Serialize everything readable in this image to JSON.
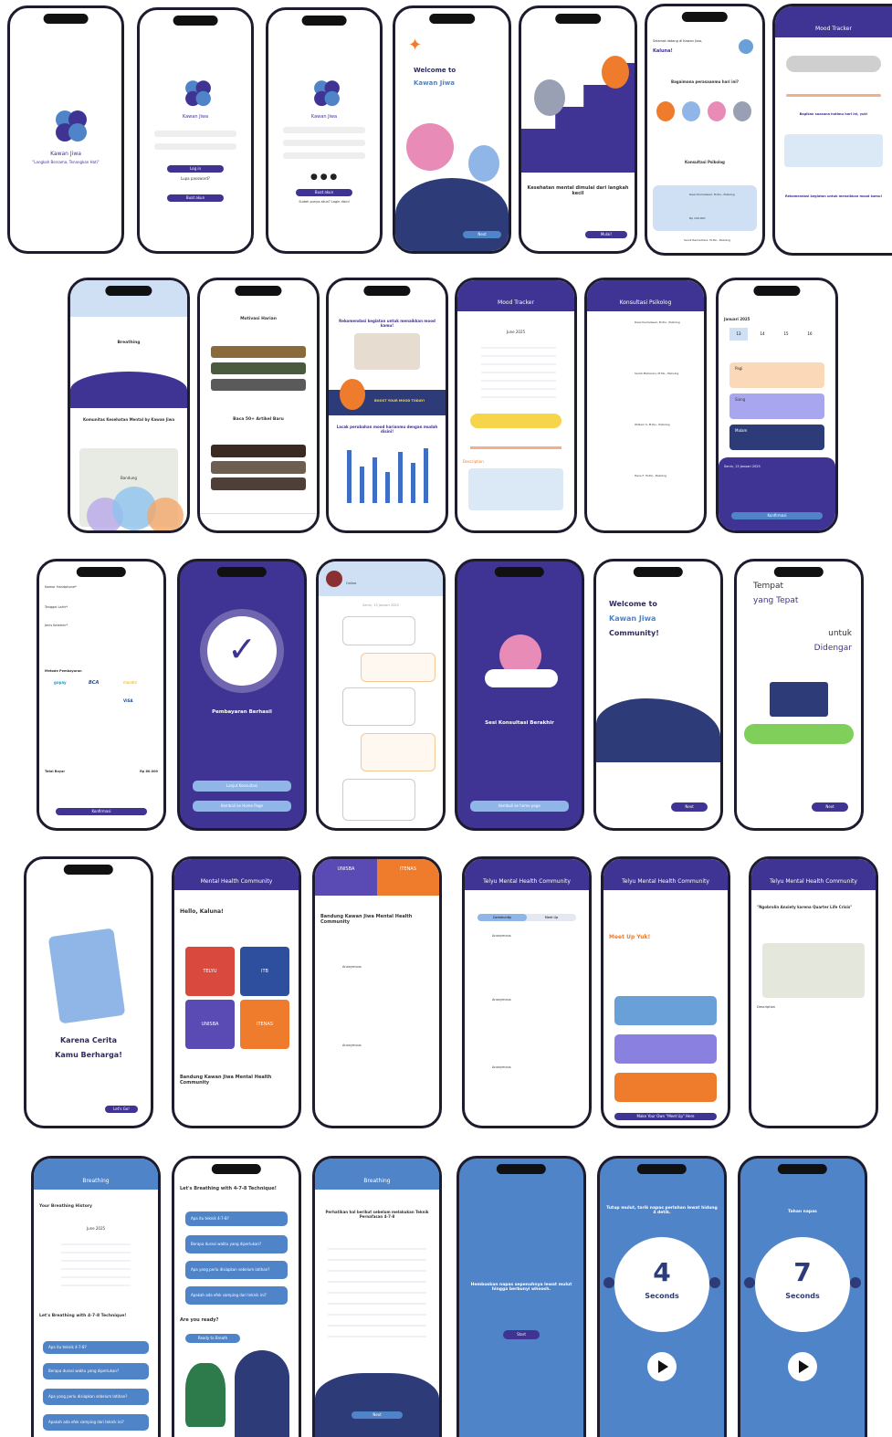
{
  "row1": {
    "splash_app_name": "Kawan Jiwa",
    "splash_tagline": "\"Langkah Bersama, Tenangkan Hati\"",
    "login_title": "Kawan Jiwa",
    "login_btn": "Log in",
    "login_forgot": "Lupa password?",
    "login_register": "Buat akun",
    "register_title": "Kawan Jiwa",
    "register_btn": "Buat akun",
    "register_login": "Sudah punya akun? Login disini",
    "welcome_title_1": "Welcome to",
    "welcome_title_2": "Kawan Jiwa",
    "welcome_next": "Next",
    "onb2_title": "Kesehatan mental dimulai dari langkah kecil",
    "onb2_btn": "Mulai!",
    "home_greeting": "Selamat datang di Kawan Jiwa,",
    "home_user": "Kaluna!",
    "home_question": "Bagaimana perasaanmu hari ini?",
    "home_konsultasi": "Konsultasi Psikolog",
    "home_psych_1": "Dewi Kumalasari, M.Psi., Psikolog",
    "home_price": "Rp 100.000",
    "home_psych_2": "Sandi Ramadhani, M.Psi., Psikolog",
    "mood_header": "Mood Tracker",
    "mood_share": "Bagikan suasana hatimu hari ini, yuk!",
    "mood_reco": "Rekomendasi kegiatan untuk menaikkan mood kamu!"
  },
  "row2": {
    "breathing_title": "Breathing",
    "community_title": "Komunitas Kesehatan Mental by Kawan Jiwa",
    "map_city": "Bandung",
    "motivasi_title": "Motivasi Harian",
    "artikel_title": "Baca 50+ Artikel Baru",
    "reco_title": "Rekomendasi kegiatan untuk menaikkan mood kamu!",
    "boost_banner": "BOOST YOUR MOOD TODAY!",
    "chart_title": "Lacak perubahan mood harianmu dengan mudah disini!",
    "calendar_header": "Mood Tracker",
    "calendar_month": "June 2025",
    "description_label": "Description",
    "konsultasi_header": "Konsultasi Psikolog",
    "psych_a": "Dewi Kumalasari, M.Psi., Psikolog",
    "psych_b": "Sarah Maharani, M.Psi., Psikolog",
    "psych_c": "William S, M.Psi., Psikolog",
    "psych_d": "Hans F, M.Psi., Psikolog",
    "schedule_month": "Januari 2025",
    "schedule_days": [
      "13",
      "14",
      "15",
      "16"
    ],
    "pagi": "Pagi",
    "siang": "Siang",
    "malam": "Malam",
    "konfirmasi": "Konfirmasi",
    "booking_date": "Senin, 13 Januari 2025"
  },
  "row3": {
    "pay_phone_label": "Nomor Handphone*",
    "pay_birth_label": "Tanggal Lahir*",
    "pay_gender_label": "Jenis Kelamin*",
    "pay_method_label": "Metode Pembayaran",
    "pay_methods": [
      "gopay",
      "BCA",
      "mandiri",
      "",
      "",
      "VISA"
    ],
    "pay_total_label": "Total Bayar",
    "pay_total": "Rp 80.000",
    "pay_confirm": "Konfirmasi",
    "success_title": "Pembayaran Berhasil",
    "success_btn1": "Lanjut Konsultasi",
    "success_btn2": "Kembali ke Home Page",
    "chat_status": "Online",
    "chat_date": "Senin, 13 Januari 2025",
    "session_end_title": "Sesi Konsultasi Berakhir",
    "session_end_btn": "Kembali ke home page",
    "comm_welcome_1": "Welcome to",
    "comm_welcome_2": "Kawan Jiwa",
    "comm_welcome_3": "Community!",
    "comm_next": "Next",
    "place_1": "Tempat",
    "place_2": "yang Tepat",
    "place_3": "untuk",
    "place_4": "Didengar",
    "place_next": "Next"
  },
  "row4": {
    "story_1": "Karena Cerita",
    "story_2": "Kamu Berharga!",
    "story_btn": "Let's Go!",
    "mhc_header": "Mental Health Community",
    "mhc_hello": "Hello, Kaluna!",
    "mhc_tiles": [
      "TELYU",
      "ITB",
      "UNISBA",
      "ITENAS"
    ],
    "mhc_bottom": "Bandung Kawan Jiwa Mental Health Community",
    "bkj_title": "Bandung Kawan Jiwa Mental Health Community",
    "bkj_banner": [
      "UNISBA",
      "ITENAS"
    ],
    "tc_header": "Telyu Mental Health Community",
    "tc_tabs": [
      "Community",
      "Meet Up"
    ],
    "anonymous": "Anonymous",
    "meetup_header": "Telyu Mental Health Community",
    "meetup_title": "Meet Up Yuk!",
    "meetup_cta": "Make Your Own \"Meet Up\" Here",
    "event_header": "Telyu Mental Health Community",
    "event_title": "\"Ngobrolin Anxiety karena Quarter Life Crisis\"",
    "event_desc": "Description"
  },
  "row5": {
    "breath_header": "Breathing",
    "history_title": "Your Breathing History",
    "history_month": "June 2025",
    "lets_breath": "Let's Breathing with 4-7-8 Technique!",
    "faq_1": "Apa itu teknik 4-7-8?",
    "faq_2": "Berapa durasi waktu yang diperlukan?",
    "faq_3": "Apa yang perlu disiapkan sebelum latihan?",
    "faq_4": "Apakah ada efek samping dari teknik ini?",
    "ready": "Are you ready?",
    "ready_btn": "Ready to Breath",
    "tech_header": "Breathing",
    "tech_title": "Perhatikan hal berikut sebelum melakukan Teknik Pernafasan 4-7-8",
    "tech_next": "Next",
    "exhale_text": "Hembuskan napas sepenuhnya lewat mulut hingga berbunyi whoosh.",
    "exhale_btn": "Start",
    "inhale_text": "Tutup mulut, tarik napas perlahan lewat hidung 4 detik.",
    "inhale_num": "4",
    "seconds": "Seconds",
    "hold_text": "Tahan napas",
    "hold_num": "7"
  },
  "colors": {
    "navy": "#3f3394",
    "blue": "#4f84c8",
    "orange": "#ef7b2c",
    "pink": "#e88bb6",
    "yellow": "#f7d54a"
  }
}
